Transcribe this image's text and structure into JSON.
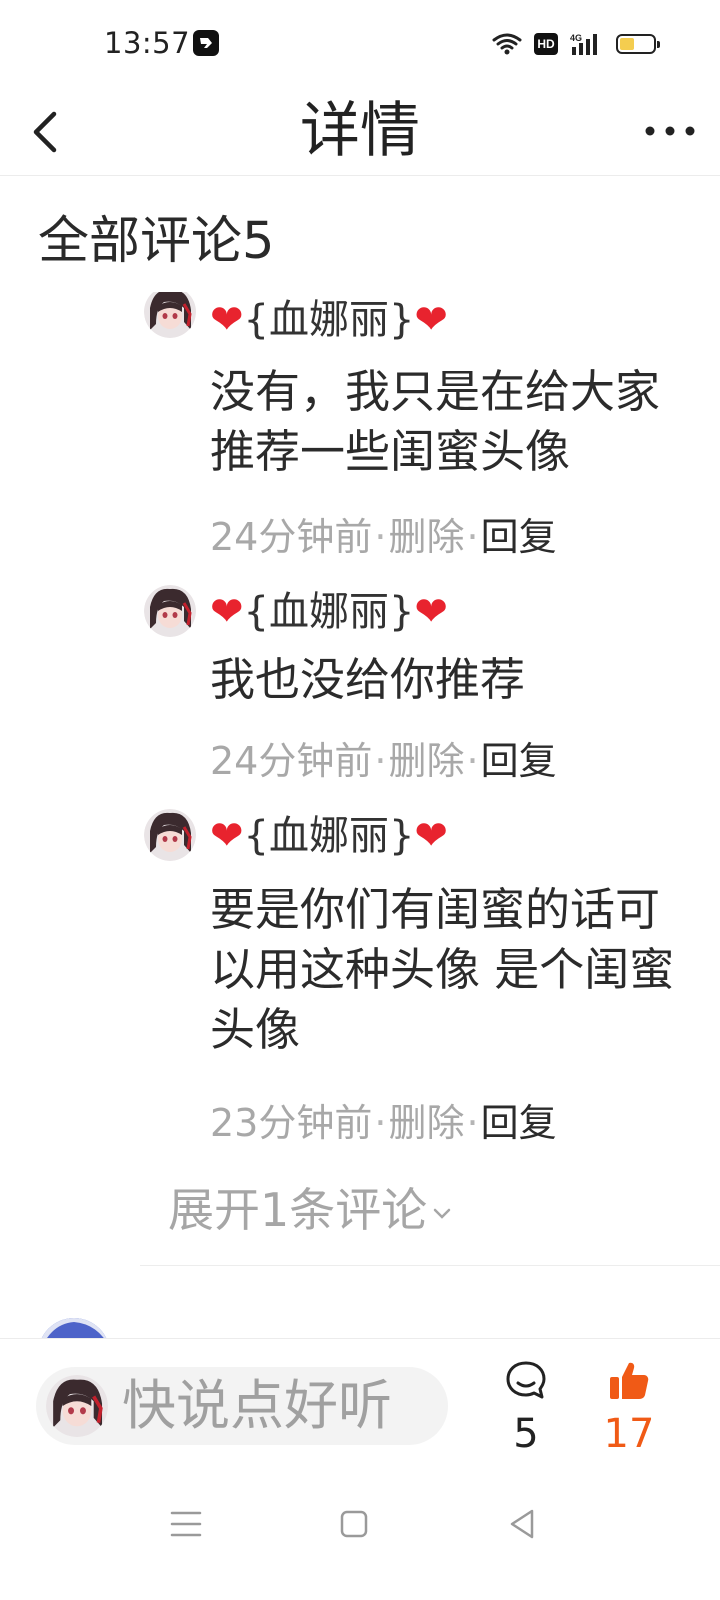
{
  "status_bar": {
    "time": "13:57",
    "hd_badge": "HD",
    "network": "4G",
    "battery_level": 0.45
  },
  "header": {
    "title": "详情"
  },
  "comments_section": {
    "title": "全部评论5"
  },
  "replies": [
    {
      "name_prefix": "❤",
      "name": "{血娜丽}",
      "name_suffix": "❤",
      "text": "没有，我只是在给大家推荐一些闺蜜头像",
      "time": "24分钟前",
      "delete_label": "删除",
      "reply_label": "回复"
    },
    {
      "name_prefix": "❤",
      "name": "{血娜丽}",
      "name_suffix": "❤",
      "text": "我也没给你推荐",
      "time": "24分钟前",
      "delete_label": "删除",
      "reply_label": "回复"
    },
    {
      "name_prefix": "❤",
      "name": "{血娜丽}",
      "name_suffix": "❤",
      "text": "要是你们有闺蜜的话可以用这种头像 是个闺蜜头像",
      "time": "23分钟前",
      "delete_label": "删除",
      "reply_label": "回复"
    }
  ],
  "expand_label": "展开1条评论",
  "bottom_bar": {
    "input_placeholder": "快说点好听",
    "comment_count": "5",
    "like_count": "17"
  },
  "colors": {
    "heart": "#e8232e",
    "like_accent": "#f05a16",
    "muted_text": "#a8a8a8"
  },
  "icons": {
    "back": "chevron-left-icon",
    "more": "more-dots-icon",
    "comment": "comment-bubble-icon",
    "like": "thumbs-up-icon",
    "expand": "chevron-down-icon"
  }
}
